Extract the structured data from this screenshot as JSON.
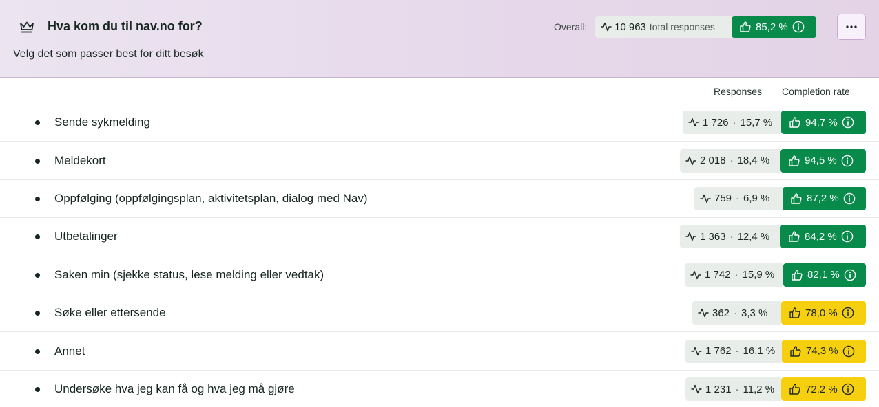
{
  "question": {
    "title": "Hva kom du til nav.no for?",
    "subtitle": "Velg det som passer best for ditt besøk",
    "icon": "crown-icon"
  },
  "overall": {
    "label": "Overall:",
    "responses": "10 963",
    "responses_unit": "total responses",
    "rate": "85,2 %"
  },
  "columns": {
    "responses": "Responses",
    "completion": "Completion rate"
  },
  "colors": {
    "green": "#088a4b",
    "yellow": "#f6cf0f",
    "response_bg": "#e8ede9",
    "header_bg": "#e8dcec"
  },
  "options": [
    {
      "label": "Sende sykmelding",
      "count": "1 726",
      "share": "15,7 %",
      "rate": "94,7 %",
      "status": "green"
    },
    {
      "label": "Meldekort",
      "count": "2 018",
      "share": "18,4 %",
      "rate": "94,5 %",
      "status": "green"
    },
    {
      "label": "Oppfølging (oppfølgingsplan, aktivitetsplan, dialog med Nav)",
      "count": "759",
      "share": "6,9 %",
      "rate": "87,2 %",
      "status": "green"
    },
    {
      "label": "Utbetalinger",
      "count": "1 363",
      "share": "12,4 %",
      "rate": "84,2 %",
      "status": "green"
    },
    {
      "label": "Saken min (sjekke status, lese melding eller vedtak)",
      "count": "1 742",
      "share": "15,9 %",
      "rate": "82,1 %",
      "status": "green"
    },
    {
      "label": "Søke eller ettersende",
      "count": "362",
      "share": "3,3 %",
      "rate": "78,0 %",
      "status": "yellow"
    },
    {
      "label": "Annet",
      "count": "1 762",
      "share": "16,1 %",
      "rate": "74,3 %",
      "status": "yellow"
    },
    {
      "label": "Undersøke hva jeg kan få og hva jeg må gjøre",
      "count": "1 231",
      "share": "11,2 %",
      "rate": "72,2 %",
      "status": "yellow"
    }
  ]
}
